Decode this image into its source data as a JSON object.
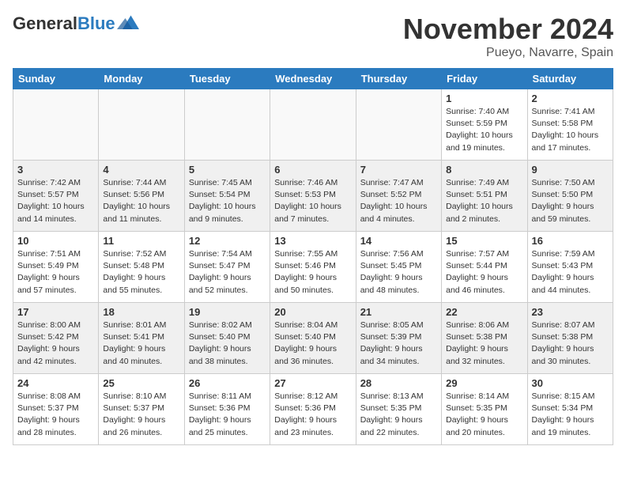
{
  "logo": {
    "general": "General",
    "blue": "Blue"
  },
  "title": "November 2024",
  "location": "Pueyo, Navarre, Spain",
  "days_of_week": [
    "Sunday",
    "Monday",
    "Tuesday",
    "Wednesday",
    "Thursday",
    "Friday",
    "Saturday"
  ],
  "weeks": [
    [
      {
        "day": "",
        "info": ""
      },
      {
        "day": "",
        "info": ""
      },
      {
        "day": "",
        "info": ""
      },
      {
        "day": "",
        "info": ""
      },
      {
        "day": "",
        "info": ""
      },
      {
        "day": "1",
        "info": "Sunrise: 7:40 AM\nSunset: 5:59 PM\nDaylight: 10 hours and 19 minutes."
      },
      {
        "day": "2",
        "info": "Sunrise: 7:41 AM\nSunset: 5:58 PM\nDaylight: 10 hours and 17 minutes."
      }
    ],
    [
      {
        "day": "3",
        "info": "Sunrise: 7:42 AM\nSunset: 5:57 PM\nDaylight: 10 hours and 14 minutes."
      },
      {
        "day": "4",
        "info": "Sunrise: 7:44 AM\nSunset: 5:56 PM\nDaylight: 10 hours and 11 minutes."
      },
      {
        "day": "5",
        "info": "Sunrise: 7:45 AM\nSunset: 5:54 PM\nDaylight: 10 hours and 9 minutes."
      },
      {
        "day": "6",
        "info": "Sunrise: 7:46 AM\nSunset: 5:53 PM\nDaylight: 10 hours and 7 minutes."
      },
      {
        "day": "7",
        "info": "Sunrise: 7:47 AM\nSunset: 5:52 PM\nDaylight: 10 hours and 4 minutes."
      },
      {
        "day": "8",
        "info": "Sunrise: 7:49 AM\nSunset: 5:51 PM\nDaylight: 10 hours and 2 minutes."
      },
      {
        "day": "9",
        "info": "Sunrise: 7:50 AM\nSunset: 5:50 PM\nDaylight: 9 hours and 59 minutes."
      }
    ],
    [
      {
        "day": "10",
        "info": "Sunrise: 7:51 AM\nSunset: 5:49 PM\nDaylight: 9 hours and 57 minutes."
      },
      {
        "day": "11",
        "info": "Sunrise: 7:52 AM\nSunset: 5:48 PM\nDaylight: 9 hours and 55 minutes."
      },
      {
        "day": "12",
        "info": "Sunrise: 7:54 AM\nSunset: 5:47 PM\nDaylight: 9 hours and 52 minutes."
      },
      {
        "day": "13",
        "info": "Sunrise: 7:55 AM\nSunset: 5:46 PM\nDaylight: 9 hours and 50 minutes."
      },
      {
        "day": "14",
        "info": "Sunrise: 7:56 AM\nSunset: 5:45 PM\nDaylight: 9 hours and 48 minutes."
      },
      {
        "day": "15",
        "info": "Sunrise: 7:57 AM\nSunset: 5:44 PM\nDaylight: 9 hours and 46 minutes."
      },
      {
        "day": "16",
        "info": "Sunrise: 7:59 AM\nSunset: 5:43 PM\nDaylight: 9 hours and 44 minutes."
      }
    ],
    [
      {
        "day": "17",
        "info": "Sunrise: 8:00 AM\nSunset: 5:42 PM\nDaylight: 9 hours and 42 minutes."
      },
      {
        "day": "18",
        "info": "Sunrise: 8:01 AM\nSunset: 5:41 PM\nDaylight: 9 hours and 40 minutes."
      },
      {
        "day": "19",
        "info": "Sunrise: 8:02 AM\nSunset: 5:40 PM\nDaylight: 9 hours and 38 minutes."
      },
      {
        "day": "20",
        "info": "Sunrise: 8:04 AM\nSunset: 5:40 PM\nDaylight: 9 hours and 36 minutes."
      },
      {
        "day": "21",
        "info": "Sunrise: 8:05 AM\nSunset: 5:39 PM\nDaylight: 9 hours and 34 minutes."
      },
      {
        "day": "22",
        "info": "Sunrise: 8:06 AM\nSunset: 5:38 PM\nDaylight: 9 hours and 32 minutes."
      },
      {
        "day": "23",
        "info": "Sunrise: 8:07 AM\nSunset: 5:38 PM\nDaylight: 9 hours and 30 minutes."
      }
    ],
    [
      {
        "day": "24",
        "info": "Sunrise: 8:08 AM\nSunset: 5:37 PM\nDaylight: 9 hours and 28 minutes."
      },
      {
        "day": "25",
        "info": "Sunrise: 8:10 AM\nSunset: 5:37 PM\nDaylight: 9 hours and 26 minutes."
      },
      {
        "day": "26",
        "info": "Sunrise: 8:11 AM\nSunset: 5:36 PM\nDaylight: 9 hours and 25 minutes."
      },
      {
        "day": "27",
        "info": "Sunrise: 8:12 AM\nSunset: 5:36 PM\nDaylight: 9 hours and 23 minutes."
      },
      {
        "day": "28",
        "info": "Sunrise: 8:13 AM\nSunset: 5:35 PM\nDaylight: 9 hours and 22 minutes."
      },
      {
        "day": "29",
        "info": "Sunrise: 8:14 AM\nSunset: 5:35 PM\nDaylight: 9 hours and 20 minutes."
      },
      {
        "day": "30",
        "info": "Sunrise: 8:15 AM\nSunset: 5:34 PM\nDaylight: 9 hours and 19 minutes."
      }
    ]
  ]
}
